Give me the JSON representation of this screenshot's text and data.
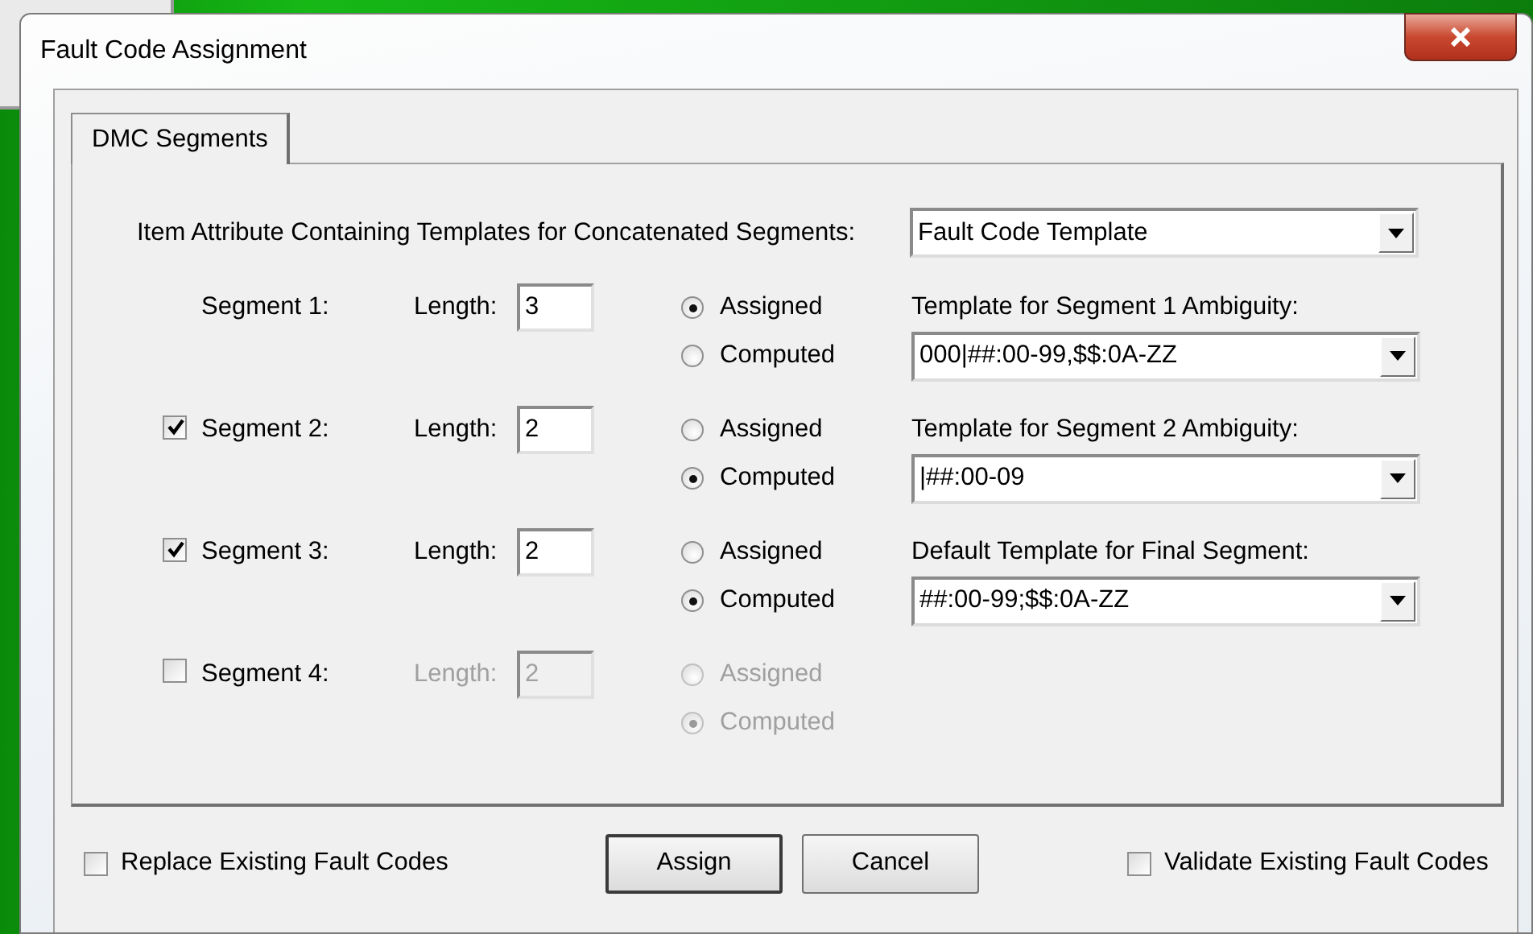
{
  "window": {
    "title": "Fault Code Assignment"
  },
  "tabs": [
    {
      "label": "DMC Segments",
      "selected": true
    }
  ],
  "attribute": {
    "label": "Item Attribute Containing Templates for Concatenated Segments:",
    "value": "Fault Code Template"
  },
  "segments": [
    {
      "kind": "fixed",
      "label": "Segment 1:",
      "length_label": "Length:",
      "length": "3",
      "enabled": true,
      "options": [
        {
          "label": "Assigned",
          "selected": true
        },
        {
          "label": "Computed",
          "selected": false
        }
      ]
    },
    {
      "kind": "optional",
      "checked": true,
      "label": "Segment 2:",
      "length_label": "Length:",
      "length": "2",
      "enabled": true,
      "options": [
        {
          "label": "Assigned",
          "selected": false
        },
        {
          "label": "Computed",
          "selected": true
        }
      ]
    },
    {
      "kind": "optional",
      "checked": true,
      "label": "Segment 3:",
      "length_label": "Length:",
      "length": "2",
      "enabled": true,
      "options": [
        {
          "label": "Assigned",
          "selected": false
        },
        {
          "label": "Computed",
          "selected": true
        }
      ]
    },
    {
      "kind": "optional",
      "checked": false,
      "label": "Segment 4:",
      "length_label": "Length:",
      "length": "2",
      "enabled": false,
      "options": [
        {
          "label": "Assigned",
          "selected": false
        },
        {
          "label": "Computed",
          "selected": true
        }
      ]
    }
  ],
  "templates": [
    {
      "label": "Template for Segment 1 Ambiguity:",
      "value": "000|##:00-99,$$:0A-ZZ"
    },
    {
      "label": "Template for Segment 2 Ambiguity:",
      "value": "|##:00-09"
    },
    {
      "label": "Default Template for Final Segment:",
      "value": "##:00-99;$$:0A-ZZ"
    }
  ],
  "replace": {
    "label": "Replace Existing Fault Codes",
    "checked": false
  },
  "buttons": [
    {
      "label": "Assign",
      "default": true
    },
    {
      "label": "Cancel",
      "default": false
    }
  ],
  "validate": {
    "label": "Validate Existing Fault Codes",
    "checked": false
  }
}
